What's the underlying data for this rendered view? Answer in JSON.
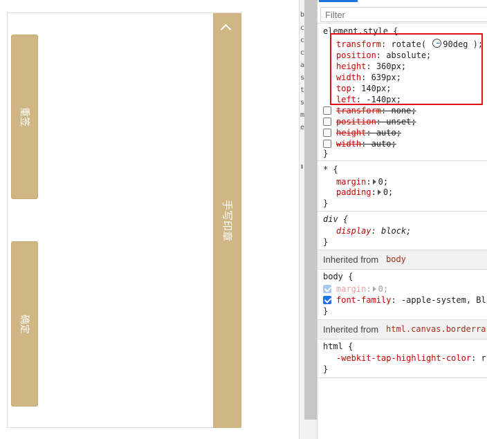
{
  "preview": {
    "top_button_label": "重签",
    "bottom_button_label": "确定",
    "side_bar_label": "手写印章"
  },
  "dock_left_letters": [
    "b",
    "c",
    "c",
    "c",
    "a",
    "s",
    "t",
    "s",
    "m",
    "e"
  ],
  "styles": {
    "filter_placeholder": "Filter",
    "element_style": {
      "selector": "element.style {",
      "rotate_prefix": "rotate(",
      "rotate_value": "90deg",
      "rotate_suffix": ");",
      "lines": [
        {
          "prop": "transform",
          "val": "rotate( 90deg );"
        },
        {
          "prop": "position",
          "val": "absolute;"
        },
        {
          "prop": "height",
          "val": "360px;"
        },
        {
          "prop": "width",
          "val": "639px;"
        },
        {
          "prop": "top",
          "val": "140px;"
        },
        {
          "prop": "left",
          "val": "-140px;"
        }
      ],
      "overridden": [
        {
          "prop": "transform",
          "val": "none;"
        },
        {
          "prop": "position",
          "val": "unset;"
        },
        {
          "prop": "height",
          "val": "auto;"
        },
        {
          "prop": "width",
          "val": "auto;"
        }
      ],
      "close": "}"
    },
    "universal_rule": {
      "selector": "* {",
      "lines": [
        {
          "prop": "margin",
          "val": "0;"
        },
        {
          "prop": "padding",
          "val": "0;"
        }
      ],
      "close": "}"
    },
    "div_rule": {
      "selector": "div {",
      "prop": "display",
      "val": "block;",
      "close": "}"
    },
    "inherited_body": {
      "label": "Inherited from",
      "tag": "body"
    },
    "body_rule": {
      "selector": "body {",
      "margin_prop": "margin",
      "margin_val": "0;",
      "font_prop": "font-family",
      "font_val": "-apple-system, Bl",
      "close": "}"
    },
    "inherited_html": {
      "label": "Inherited from",
      "tag": "html.canvas.borderra"
    },
    "html_rule": {
      "selector": "html {",
      "prop": "-webkit-tap-highlight-color",
      "val": "r",
      "close": "}"
    }
  },
  "colors": {
    "accent_gold": "#cfb684",
    "css_property": "#c80000",
    "highlight_box": "#e3101a",
    "checkbox_blue": "#1a73e8"
  }
}
